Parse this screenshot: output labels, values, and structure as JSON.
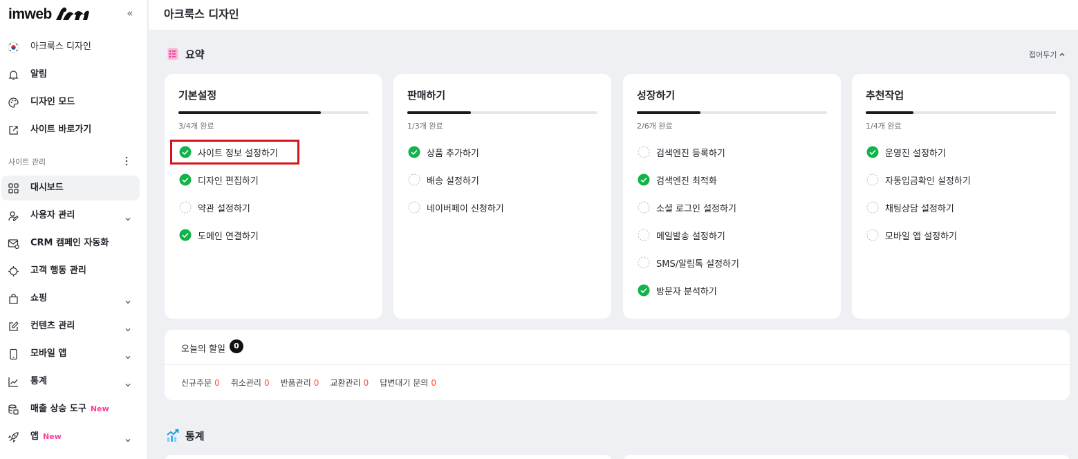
{
  "sidebar": {
    "logo_text": "imweb",
    "collapse_icon": "double-chevron-left-icon",
    "top_items": [
      {
        "label": "아크룩스 디자인",
        "icon": "flag-icon"
      },
      {
        "label": "알림",
        "icon": "bell-icon"
      },
      {
        "label": "디자인 모드",
        "icon": "palette-icon"
      },
      {
        "label": "사이트 바로가기",
        "icon": "external-link-icon"
      }
    ],
    "section_label": "사이트 관리",
    "items": [
      {
        "label": "대시보드",
        "icon": "grid-icon",
        "active": true
      },
      {
        "label": "사용자 관리",
        "icon": "users-icon",
        "chevron": true
      },
      {
        "label": "CRM 캠페인 자동화",
        "icon": "mail-icon"
      },
      {
        "label": "고객 행동 관리",
        "icon": "target-icon"
      },
      {
        "label": "쇼핑",
        "icon": "bag-icon",
        "chevron": true
      },
      {
        "label": "컨텐츠 관리",
        "icon": "edit-icon",
        "chevron": true
      },
      {
        "label": "모바일 앱",
        "icon": "mobile-icon",
        "chevron": true
      },
      {
        "label": "통계",
        "icon": "chart-icon",
        "chevron": true
      },
      {
        "label": "매출 상승 도구",
        "icon": "coins-icon",
        "badge": "New"
      },
      {
        "label": "앱",
        "icon": "rocket-icon",
        "badge": "New",
        "chevron": true
      }
    ]
  },
  "header": {
    "title": "아크룩스 디자인"
  },
  "summary": {
    "title": "요약",
    "fold_label": "접어두기",
    "cards": [
      {
        "title": "기본설정",
        "progress_text": "3/4개 완료",
        "progress": 0.75,
        "tasks": [
          {
            "label": "사이트 정보 설정하기",
            "done": true,
            "highlight": true
          },
          {
            "label": "디자인 편집하기",
            "done": true
          },
          {
            "label": "약관 설정하기",
            "done": false
          },
          {
            "label": "도메인 연결하기",
            "done": true
          }
        ]
      },
      {
        "title": "판매하기",
        "progress_text": "1/3개 완료",
        "progress": 0.333,
        "tasks": [
          {
            "label": "상품 추가하기",
            "done": true
          },
          {
            "label": "배송 설정하기",
            "done": false
          },
          {
            "label": "네이버페이 신청하기",
            "done": false
          }
        ]
      },
      {
        "title": "성장하기",
        "progress_text": "2/6개 완료",
        "progress": 0.333,
        "tasks": [
          {
            "label": "검색엔진 등록하기",
            "done": false
          },
          {
            "label": "검색엔진 최적화",
            "done": true
          },
          {
            "label": "소셜 로그인 설정하기",
            "done": false
          },
          {
            "label": "메일발송 설정하기",
            "done": false
          },
          {
            "label": "SMS/알림톡 설정하기",
            "done": false
          },
          {
            "label": "방문자 분석하기",
            "done": true
          }
        ]
      },
      {
        "title": "추천작업",
        "progress_text": "1/4개 완료",
        "progress": 0.25,
        "tasks": [
          {
            "label": "운영진 설정하기",
            "done": true
          },
          {
            "label": "자동입금확인 설정하기",
            "done": false
          },
          {
            "label": "채팅상담 설정하기",
            "done": false
          },
          {
            "label": "모바일 앱 설정하기",
            "done": false
          }
        ]
      }
    ]
  },
  "today": {
    "title": "오늘의 할일",
    "count": "0",
    "stats": [
      {
        "label": "신규주문",
        "value": "0"
      },
      {
        "label": "취소관리",
        "value": "0"
      },
      {
        "label": "반품관리",
        "value": "0"
      },
      {
        "label": "교환관리",
        "value": "0"
      },
      {
        "label": "답변대기 문의",
        "value": "0"
      }
    ]
  },
  "stats_section": {
    "title": "통계"
  },
  "colors": {
    "accent_green": "#12b34a",
    "badge_pink": "#ff3d9a",
    "alert_red": "#ff4d3d",
    "highlight_red": "#d4141c"
  }
}
